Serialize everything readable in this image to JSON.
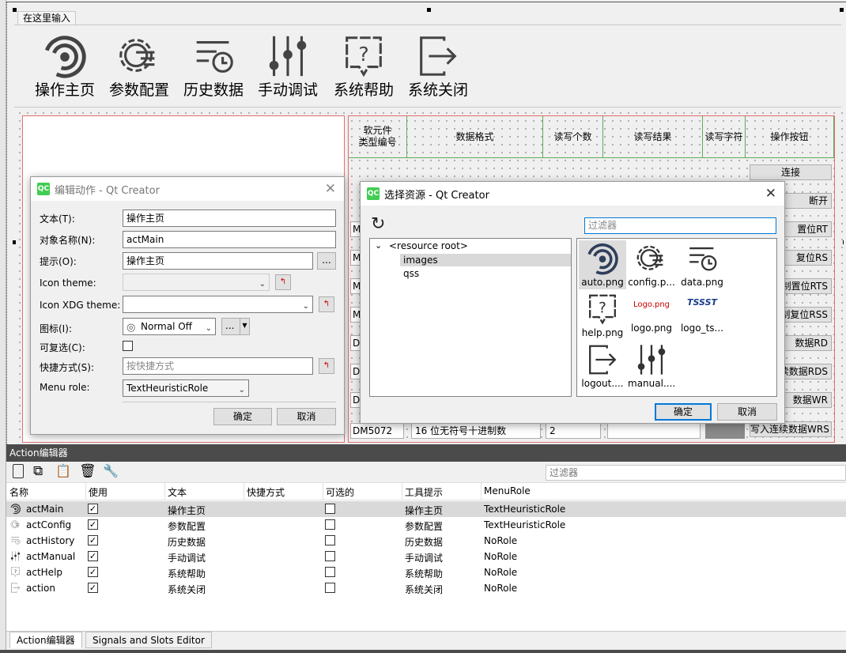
{
  "menubar": {
    "entry": "在这里输入"
  },
  "toolbar": [
    {
      "icon": "target-icon",
      "label": "操作主页"
    },
    {
      "icon": "gear-icon",
      "label": "参数配置"
    },
    {
      "icon": "history-icon",
      "label": "历史数据"
    },
    {
      "icon": "sliders-icon",
      "label": "手动调试"
    },
    {
      "icon": "help-icon",
      "label": "系统帮助"
    },
    {
      "icon": "exit-icon",
      "label": "系统关闭"
    }
  ],
  "table": {
    "headers": [
      "软元件\n类型编号",
      "数据格式",
      "读写个数",
      "读写结果",
      "读写字符",
      "操作按钮"
    ],
    "row_labels": [
      "M",
      "M",
      "M",
      "M",
      "D",
      "D",
      "D",
      "DM5072"
    ],
    "buttons": [
      "连接",
      "断开",
      "置位RT",
      "复位RS",
      "制置位RTS",
      "制复位RSS",
      "数据RD",
      "读数据RDS",
      "数据WR",
      "写入连续数据WRS"
    ],
    "last_row_format": "16 位无符号十进制数",
    "last_row_count": "2"
  },
  "edit_dialog": {
    "title": "编辑动作 - Qt Creator",
    "text_label": "文本(T):",
    "text_value": "操作主页",
    "objname_label": "对象名称(N):",
    "objname_value": "actMain",
    "tooltip_label": "提示(O):",
    "tooltip_value": "操作主页",
    "icon_theme_label": "Icon theme:",
    "icon_xdg_label": "Icon XDG theme:",
    "icon_label": "图标(I):",
    "icon_value": "Normal Off",
    "checkable_label": "可复选(C):",
    "shortcut_label": "快捷方式(S):",
    "shortcut_placeholder": "按快捷方式",
    "menu_role_label": "Menu role:",
    "menu_role_value": "TextHeuristicRole",
    "ok": "确定",
    "cancel": "取消",
    "more": "..."
  },
  "resource_dialog": {
    "title": "选择资源 - Qt Creator",
    "filter_placeholder": "过滤器",
    "tree": [
      "<resource root>",
      "images",
      "qss"
    ],
    "files": [
      {
        "icon": "target-icon",
        "name": "auto.png"
      },
      {
        "icon": "gear-icon",
        "name": "config.p..."
      },
      {
        "icon": "history-icon",
        "name": "data.png"
      },
      {
        "icon": "help-icon",
        "name": "help.png"
      },
      {
        "icon": "logo-red",
        "name": "logo.png",
        "logo_text": "Logo.png"
      },
      {
        "icon": "logo-ts",
        "name": "logo_ts...",
        "logo_text": "TSSST"
      },
      {
        "icon": "exit-icon",
        "name": "logout...."
      },
      {
        "icon": "sliders-icon",
        "name": "manual...."
      }
    ],
    "ok": "确定",
    "cancel": "取消"
  },
  "action_editor": {
    "title": "Action编辑器",
    "filter_placeholder": "过滤器",
    "columns": [
      "名称",
      "使用",
      "文本",
      "快捷方式",
      "可选的",
      "工具提示",
      "MenuRole"
    ],
    "rows": [
      {
        "icon": "target-icon",
        "name": "actMain",
        "used": true,
        "text": "操作主页",
        "shortcut": "",
        "checkable": false,
        "tooltip": "操作主页",
        "role": "TextHeuristicRole"
      },
      {
        "icon": "gear-icon",
        "name": "actConfig",
        "used": true,
        "text": "参数配置",
        "shortcut": "",
        "checkable": false,
        "tooltip": "参数配置",
        "role": "TextHeuristicRole"
      },
      {
        "icon": "history-icon",
        "name": "actHistory",
        "used": true,
        "text": "历史数据",
        "shortcut": "",
        "checkable": false,
        "tooltip": "历史数据",
        "role": "NoRole"
      },
      {
        "icon": "sliders-icon",
        "name": "actManual",
        "used": true,
        "text": "手动调试",
        "shortcut": "",
        "checkable": false,
        "tooltip": "手动调试",
        "role": "NoRole"
      },
      {
        "icon": "help-icon",
        "name": "actHelp",
        "used": true,
        "text": "系统帮助",
        "shortcut": "",
        "checkable": false,
        "tooltip": "系统帮助",
        "role": "NoRole"
      },
      {
        "icon": "exit-icon",
        "name": "action",
        "used": true,
        "text": "系统关闭",
        "shortcut": "",
        "checkable": false,
        "tooltip": "系统关闭",
        "role": "NoRole"
      }
    ],
    "tabs": [
      "Action编辑器",
      "Signals and Slots Editor"
    ]
  }
}
